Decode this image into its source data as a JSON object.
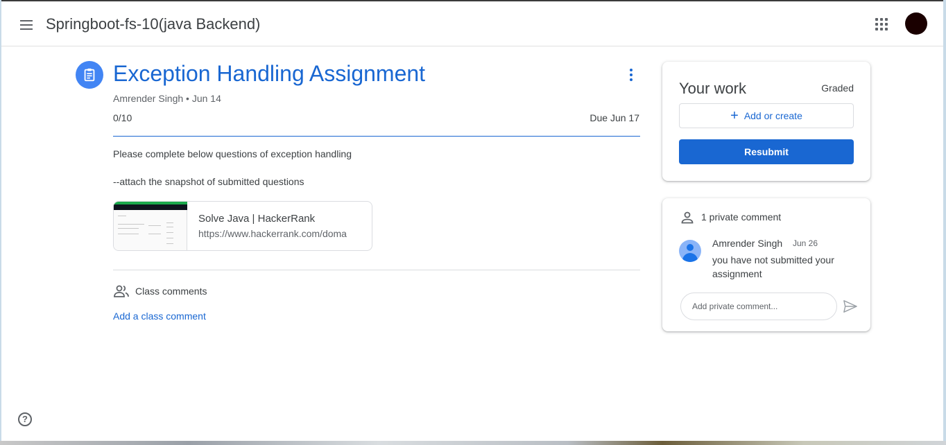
{
  "header": {
    "class_title": "Springboot-fs-10(java Backend)",
    "menu_icon": "hamburger-menu-icon",
    "apps_icon": "apps-grid-icon",
    "avatar": "account-avatar"
  },
  "assignment": {
    "icon": "assignment-clipboard-icon",
    "title": "Exception Handling Assignment",
    "author_date": "Amrender Singh • Jun 14",
    "points": "0/10",
    "due": "Due Jun 17",
    "description_line1": "Please complete below questions of exception handling",
    "description_line2": "--attach the snapshot of submitted questions",
    "attachment": {
      "title": "Solve Java | HackerRank",
      "url": "https://www.hackerrank.com/doma"
    }
  },
  "class_comments": {
    "label": "Class comments",
    "add_link": "Add a class comment"
  },
  "your_work": {
    "title": "Your work",
    "status": "Graded",
    "add_label": "Add or create",
    "resubmit_label": "Resubmit"
  },
  "private_comments": {
    "header": "1 private comment",
    "comments": [
      {
        "author": "Amrender Singh",
        "date": "Jun 26",
        "text": "you have not submitted your assignment"
      }
    ],
    "input_placeholder": "Add private comment..."
  },
  "colors": {
    "accent": "#1967d2",
    "icon_blue": "#4285f4",
    "text": "#3c4043",
    "muted": "#5f6368"
  }
}
